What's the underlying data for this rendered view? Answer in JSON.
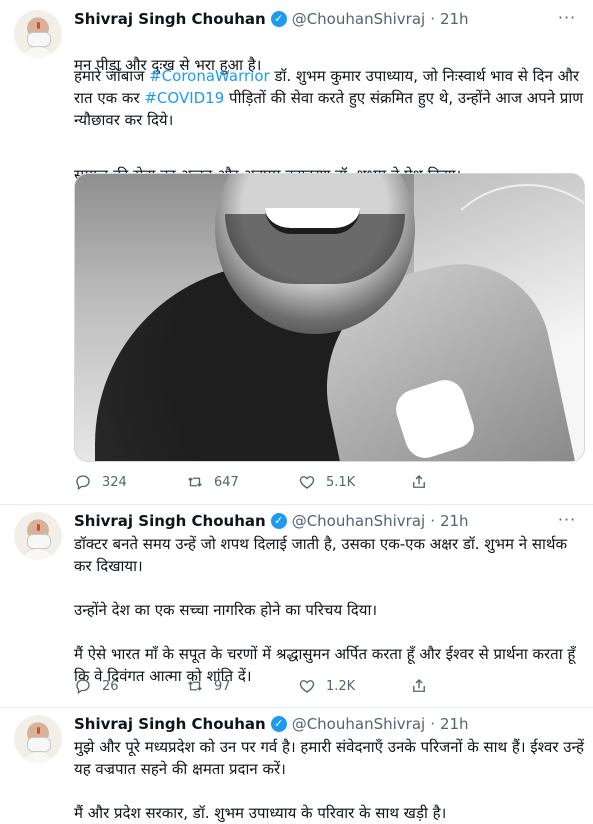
{
  "tweets": [
    {
      "name": "Shivraj Singh Chouhan",
      "handle": "@ChouhanShivraj",
      "dot": "·",
      "time": "21h",
      "text_parts": {
        "p1": "मन पीड़ा और दुःख से भरा हुआ है।",
        "p2a": "हमारे जाँबाज ",
        "hash1": "#CoronaWarrior",
        "p2b": " डॉ. शुभम कुमार उपाध्याय, जो निःस्वार्थ भाव से दिन और रात एक कर ",
        "hash2": "#COVID19",
        "p2c": " पीड़ितों की सेवा करते हुए संक्रमित हुए थे, उन्होंने आज अपने प्राण न्यौछावर कर दिये।",
        "p3": "समाज की सेवा का अद्भुत और अनुपम उदाहरण डॉ. शुभम ने पेश किया।"
      },
      "replies": "324",
      "retweets": "647",
      "likes": "5.1K"
    },
    {
      "name": "Shivraj Singh Chouhan",
      "handle": "@ChouhanShivraj",
      "dot": "·",
      "time": "21h",
      "text": "डॉक्टर बनते समय उन्हें जो शपथ दिलाई जाती है, उसका एक-एक अक्षर डॉ. शुभम ने सार्थक कर दिखाया।\n\nउन्होंने देश का एक सच्चा नागरिक होने का परिचय दिया।\n\nमैं ऐसे भारत माँ के सपूत के चरणों में श्रद्धासुमन अर्पित करता हूँ और ईश्वर से प्रार्थना करता हूँ कि वे दिवंगत आत्मा को शांति दें।",
      "replies": "26",
      "retweets": "97",
      "likes": "1.2K"
    },
    {
      "name": "Shivraj Singh Chouhan",
      "handle": "@ChouhanShivraj",
      "dot": "·",
      "time": "21h",
      "text": "मुझे और पूरे मध्यप्रदेश को उन पर गर्व है। हमारी संवेदनाएँ उनके परिजनों के साथ हैं। ईश्वर उन्हें यह वज्रपात सहने की क्षमता प्रदान करें।\n\nमैं और प्रदेश सरकार, डॉ. शुभम उपाध्याय के परिवार के साथ खड़ी है।"
    }
  ],
  "icons": {
    "verified": "verified-badge-icon",
    "reply": "reply-icon",
    "retweet": "retweet-icon",
    "like": "heart-icon",
    "share": "share-icon",
    "more": "more-icon"
  },
  "colors": {
    "accent": "#1d9bf0",
    "secondary_text": "#536471",
    "primary_text": "#0f1419",
    "divider": "#e6ecf0"
  }
}
